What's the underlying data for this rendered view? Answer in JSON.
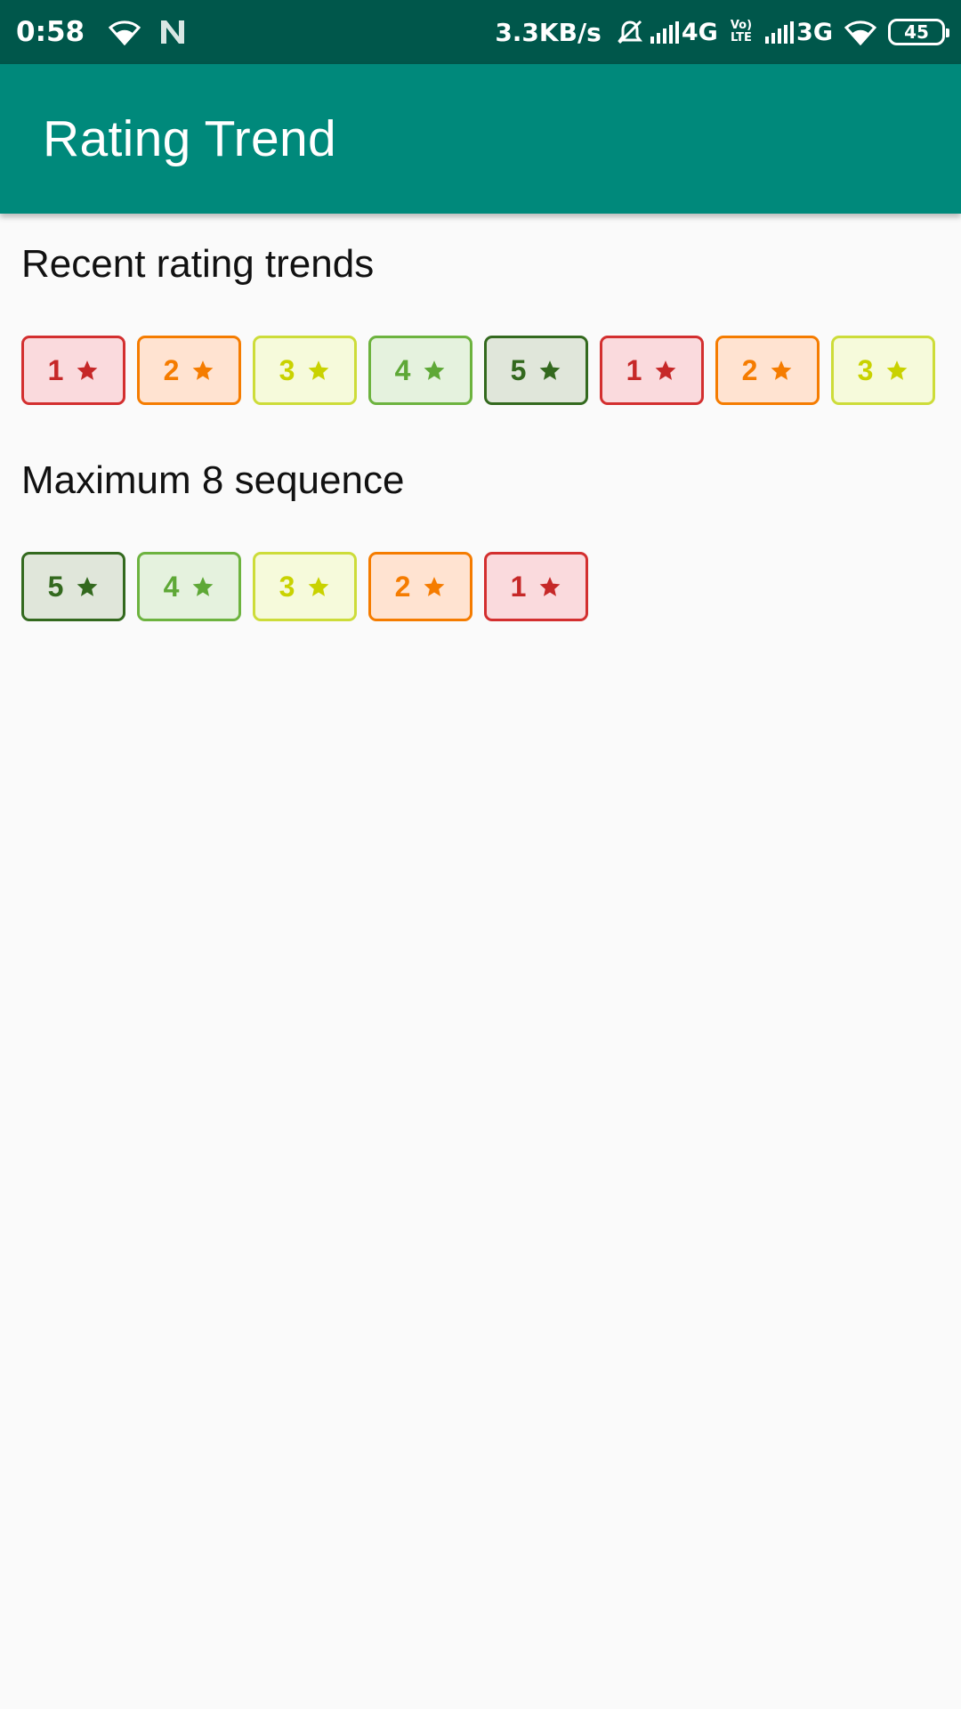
{
  "status_bar": {
    "time": "0:58",
    "speed": "3.3KB/s",
    "network_1": "4G",
    "volte_top": "Vo)",
    "volte_bottom": "LTE",
    "network_2": "3G",
    "battery": "45"
  },
  "app_bar": {
    "title": "Rating Trend"
  },
  "sections": [
    {
      "title": "Recent rating trends",
      "ratings": [
        "1",
        "2",
        "3",
        "4",
        "5",
        "1",
        "2",
        "3"
      ]
    },
    {
      "title": "Maximum 8 sequence",
      "ratings": [
        "5",
        "4",
        "3",
        "2",
        "1"
      ]
    }
  ],
  "colors": {
    "status_bar": "#00574b",
    "app_bar": "#00897b",
    "rating_1": "#d32f2f",
    "rating_2": "#f57c00",
    "rating_3": "#cddc39",
    "rating_4": "#6db33f",
    "rating_5": "#33691e"
  },
  "icons": {
    "chip_icon": "star-icon"
  }
}
